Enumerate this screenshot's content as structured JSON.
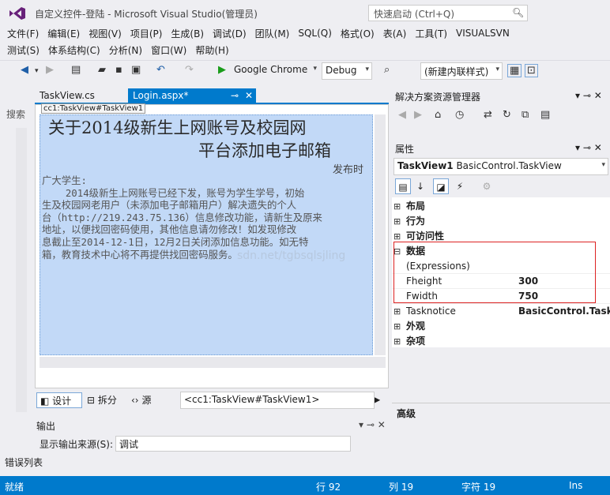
{
  "window": {
    "title": "自定义控件-登陆 - Microsoft Visual Studio(管理员)",
    "quick_launch_placeholder": "快速启动 (Ctrl+Q)"
  },
  "menus": {
    "row1": [
      "文件(F)",
      "编辑(E)",
      "视图(V)",
      "项目(P)",
      "生成(B)",
      "调试(D)",
      "团队(M)",
      "SQL(Q)",
      "格式(O)",
      "表(A)",
      "工具(T)",
      "VISUALSVN"
    ],
    "row2": [
      "测试(S)",
      "体系结构(C)",
      "分析(N)",
      "窗口(W)",
      "帮助(H)"
    ]
  },
  "toolbar": {
    "browser": "Google Chrome",
    "config": "Debug",
    "target": "(新建内联样式)"
  },
  "left_strip": {
    "search_tab": "搜索"
  },
  "doc_tabs": [
    {
      "label": "TaskView.cs"
    },
    {
      "label": "Login.aspx*"
    }
  ],
  "designer": {
    "control_tag": "cc1:TaskView#TaskView1",
    "heading_line1": "关于2014级新生上网账号及校园网",
    "heading_line2": "平台添加电子邮箱",
    "publish_time": "发布时",
    "body": "广大学生:\n    2014级新生上网账号已经下发，账号为学生学号，初始\n生及校园网老用户（未添加电子邮箱用户）解决遗失的个人\n台（http://219.243.75.136）信息修改功能，请新生及原来\n地址，以便找回密码使用，其他信息请勿修改！如发现修改\n息截止至2014-12-1日，12月2日关闭添加信息功能。如无特\n箱，教育技术中心将不再提供找回密码服务。",
    "watermark": "sdn.net/tgbsqlsjling"
  },
  "view_bar": {
    "design": "设计",
    "split": "拆分",
    "source": "源",
    "breadcrumb": "<cc1:TaskView#TaskView1>"
  },
  "output": {
    "title": "输出",
    "source_label": "显示输出来源(S):",
    "source_value": "调试"
  },
  "error_list_tab": "错误列表",
  "solution_explorer": {
    "title": "解决方案资源管理器"
  },
  "properties": {
    "title": "属性",
    "object_name": "TaskView1",
    "object_type": "BasicControl.TaskView",
    "rows": [
      {
        "expander": "⊞",
        "name": "布局",
        "value": "",
        "category": true
      },
      {
        "expander": "⊞",
        "name": "行为",
        "value": "",
        "category": true
      },
      {
        "expander": "⊞",
        "name": "可访问性",
        "value": "",
        "category": true
      },
      {
        "expander": "⊟",
        "name": "数据",
        "value": "",
        "category": true
      },
      {
        "expander": "",
        "name": "(Expressions)",
        "value": "",
        "category": false
      },
      {
        "expander": "",
        "name": "Fheight",
        "value": "300",
        "category": false
      },
      {
        "expander": "",
        "name": "Fwidth",
        "value": "750",
        "category": false
      },
      {
        "expander": "⊞",
        "name": "Tasknotice",
        "value": "BasicControl.Task",
        "category": false
      },
      {
        "expander": "⊞",
        "name": "外观",
        "value": "",
        "category": true
      },
      {
        "expander": "⊞",
        "name": "杂项",
        "value": "",
        "category": true
      }
    ],
    "description_title": "高级"
  },
  "status": {
    "ready": "就绪",
    "line": "行 92",
    "col": "列 19",
    "char": "字符 19",
    "mode": "Ins"
  },
  "colors": {
    "accent": "#007acc",
    "designer_bg": "#c2d9f7",
    "highlight_box": "#dd2222"
  }
}
